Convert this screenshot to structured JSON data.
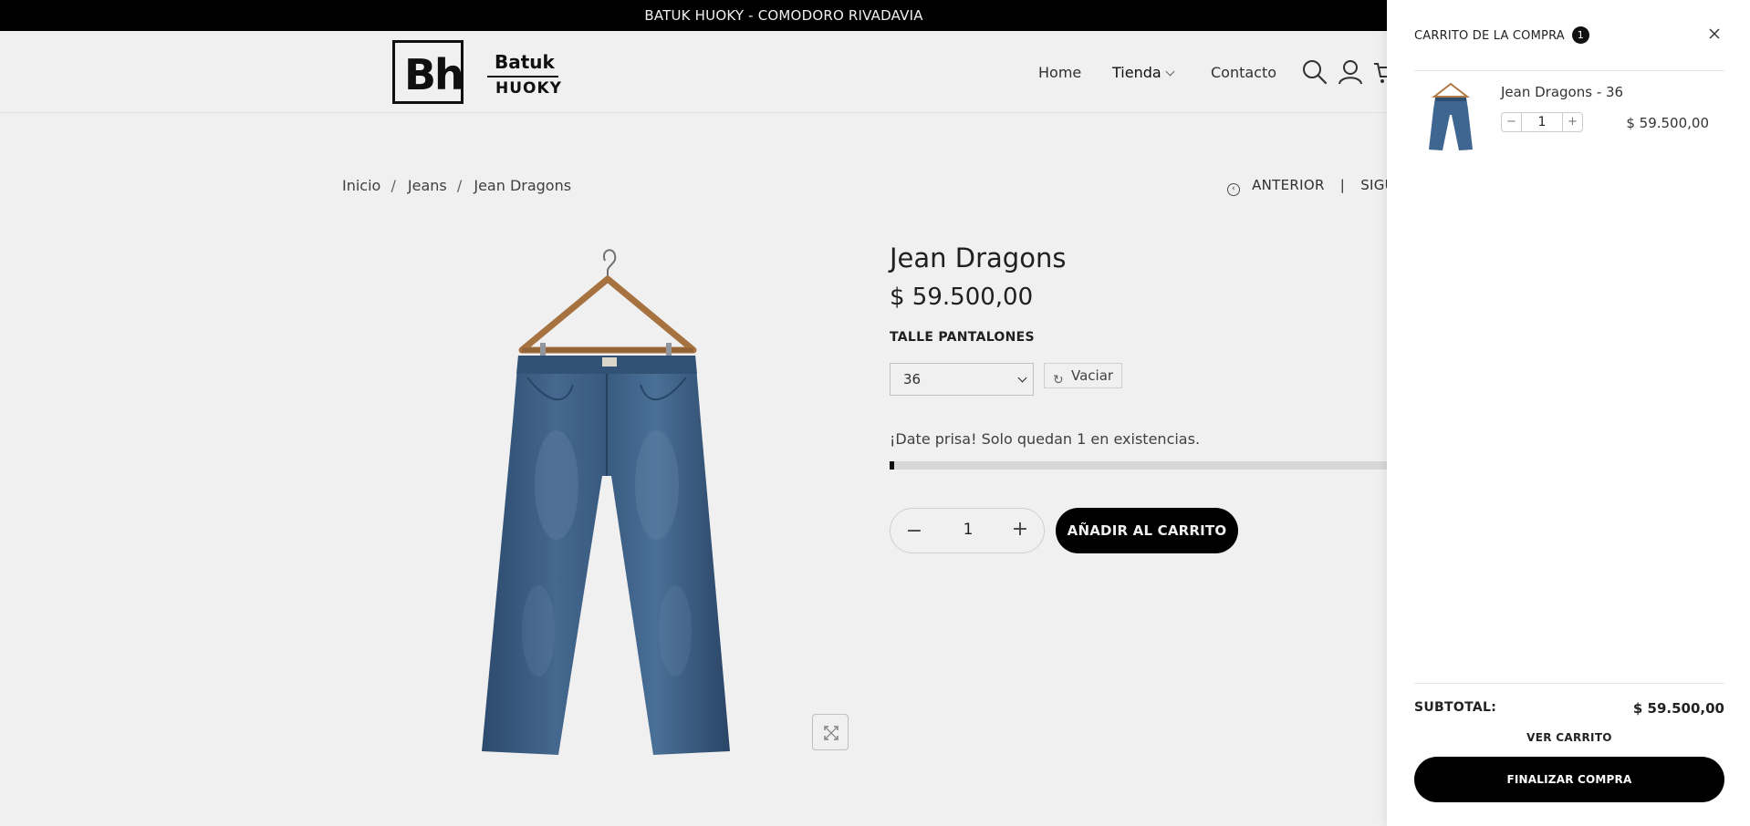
{
  "announcement": "BATUK HUOKY - COMODORO RIVADAVIA",
  "logo": {
    "mark": "Bh",
    "top": "Batuk",
    "bottom": "HUOKY"
  },
  "nav": {
    "home": "Home",
    "shop": "Tienda",
    "contact": "Contacto"
  },
  "icons": {
    "search": "search-icon",
    "account": "user-icon",
    "cart": "cart-icon"
  },
  "breadcrumb": {
    "home": "Inicio",
    "sep": "/",
    "category": "Jeans",
    "current": "Jean Dragons"
  },
  "pager": {
    "prev": "ANTERIOR",
    "sep": "|",
    "next": "SIGUIENTE"
  },
  "product": {
    "title": "Jean Dragons",
    "price": "$ 59.500,00",
    "size_label": "TALLE PANTALONES",
    "size_value": "36",
    "clear_label": "Vaciar",
    "stock_text": "¡Date prisa! Solo quedan 1 en existencias.",
    "stock_level_fraction": 0.01,
    "quantity": "1",
    "add_to_cart": "AÑADIR AL CARRITO"
  },
  "cart": {
    "title": "CARRITO DE LA COMPRA",
    "count": "1",
    "items": [
      {
        "name": "Jean Dragons - 36",
        "qty": "1",
        "price": "$ 59.500,00"
      }
    ],
    "subtotal_label": "SUBTOTAL:",
    "subtotal_value": "$ 59.500,00",
    "view_cart": "VER CARRITO",
    "checkout": "FINALIZAR COMPRA"
  },
  "colors": {
    "accent": "#000000",
    "denim": "#3b5f86",
    "hanger": "#b07a45"
  }
}
